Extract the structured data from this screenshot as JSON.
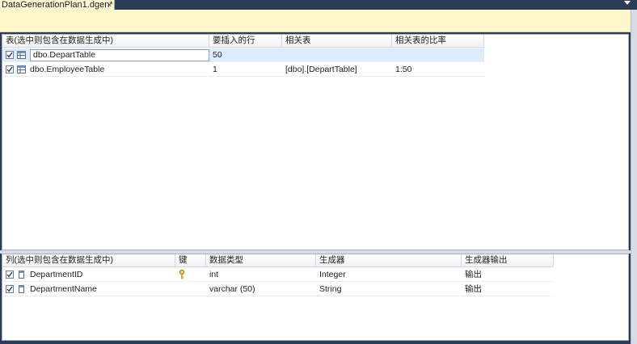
{
  "document_tab": {
    "title": "DataGenerationPlan1.dgen*",
    "close_glyph": "×"
  },
  "tables_grid": {
    "columns": [
      "表(选中则包含在数据生成中)",
      "要插入的行",
      "相关表",
      "相关表的比率"
    ],
    "rows": [
      {
        "checked": true,
        "name": "dbo.DepartTable",
        "rows_to_insert": "50",
        "related_table": "",
        "ratio": "",
        "selected": true
      },
      {
        "checked": true,
        "name": "dbo.EmployeeTable",
        "rows_to_insert": "1",
        "related_table": "[dbo].[DepartTable]",
        "ratio": "1:50",
        "selected": false
      }
    ]
  },
  "columns_grid": {
    "columns": [
      "列(选中则包含在数据生成中)",
      "键",
      "数据类型",
      "生成器",
      "生成器输出"
    ],
    "rows": [
      {
        "checked": true,
        "name": "DepartmentID",
        "key": "key-icon",
        "data_type": "int",
        "generator": "Integer",
        "generator_output": "输出"
      },
      {
        "checked": true,
        "name": "DepartmentName",
        "key": "",
        "data_type": "varchar (50)",
        "generator": "String",
        "generator_output": "输出"
      }
    ]
  },
  "icons": {
    "table": "table-icon",
    "column": "column-icon",
    "checkbox": "checkbox-checked-icon",
    "key": "key-icon"
  },
  "colors": {
    "tab_bg": "#fff7d2",
    "infobar_bg": "#fff6cc",
    "selection": "#dcecfc",
    "chrome": "#2b3c59"
  }
}
